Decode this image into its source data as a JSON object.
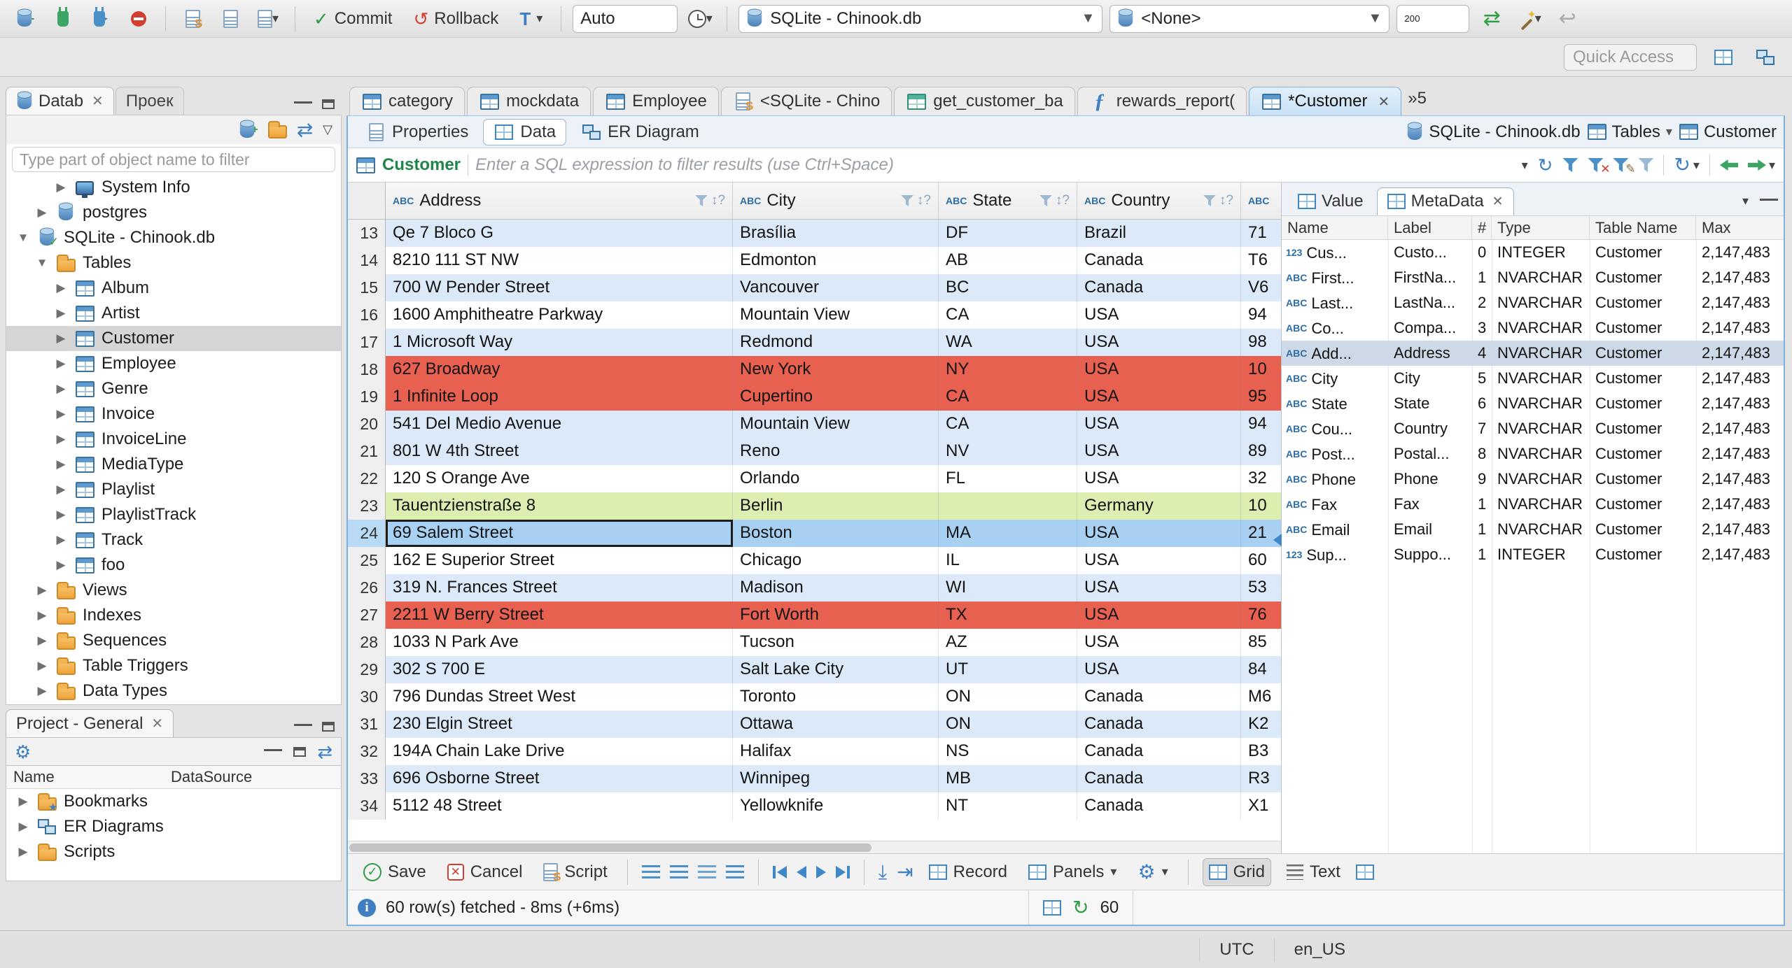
{
  "colors": {
    "accent": "#3f7fc1",
    "row_alt": "#dce9f8",
    "row_error": "#e8604f",
    "row_modified": "#ddefb0",
    "row_selected": "#a8d0f2"
  },
  "toolbar": {
    "commit_label": "Commit",
    "rollback_label": "Rollback",
    "txn_label": "T",
    "auto_commit": "Auto",
    "active_datasource": "SQLite - Chinook.db",
    "active_schema": "<None>",
    "fetch_size": "200",
    "quick_access_placeholder": "Quick Access"
  },
  "navigator": {
    "tab_database": "Datab",
    "tab_projects": "Проек",
    "filter_placeholder": "Type part of object name to filter",
    "tree": [
      {
        "label": "System Info",
        "icon": "system-info-icon",
        "arrow": "▶",
        "cls": "ind2"
      },
      {
        "label": "postgres",
        "icon": "database-icon",
        "arrow": "▶",
        "cls": "ind1"
      },
      {
        "label": "SQLite - Chinook.db",
        "icon": "database-connected-icon",
        "arrow": "▼",
        "cls": "ind0"
      },
      {
        "label": "Tables",
        "icon": "folder-icon",
        "arrow": "▼",
        "cls": "ind1"
      },
      {
        "label": "Album",
        "icon": "table-icon",
        "arrow": "▶",
        "cls": "ind2"
      },
      {
        "label": "Artist",
        "icon": "table-icon",
        "arrow": "▶",
        "cls": "ind2"
      },
      {
        "label": "Customer",
        "icon": "table-icon",
        "arrow": "▶",
        "cls": "ind2 selected"
      },
      {
        "label": "Employee",
        "icon": "table-icon",
        "arrow": "▶",
        "cls": "ind2"
      },
      {
        "label": "Genre",
        "icon": "table-icon",
        "arrow": "▶",
        "cls": "ind2"
      },
      {
        "label": "Invoice",
        "icon": "table-icon",
        "arrow": "▶",
        "cls": "ind2"
      },
      {
        "label": "InvoiceLine",
        "icon": "table-icon",
        "arrow": "▶",
        "cls": "ind2"
      },
      {
        "label": "MediaType",
        "icon": "table-icon",
        "arrow": "▶",
        "cls": "ind2"
      },
      {
        "label": "Playlist",
        "icon": "table-icon",
        "arrow": "▶",
        "cls": "ind2"
      },
      {
        "label": "PlaylistTrack",
        "icon": "table-icon",
        "arrow": "▶",
        "cls": "ind2"
      },
      {
        "label": "Track",
        "icon": "table-icon",
        "arrow": "▶",
        "cls": "ind2"
      },
      {
        "label": "foo",
        "icon": "table-icon",
        "arrow": "▶",
        "cls": "ind2"
      },
      {
        "label": "Views",
        "icon": "folder-icon",
        "arrow": "▶",
        "cls": "ind1"
      },
      {
        "label": "Indexes",
        "icon": "folder-icon",
        "arrow": "▶",
        "cls": "ind1"
      },
      {
        "label": "Sequences",
        "icon": "folder-icon",
        "arrow": "▶",
        "cls": "ind1"
      },
      {
        "label": "Table Triggers",
        "icon": "folder-icon",
        "arrow": "▶",
        "cls": "ind1"
      },
      {
        "label": "Data Types",
        "icon": "folder-icon",
        "arrow": "▶",
        "cls": "ind1"
      }
    ]
  },
  "project_panel": {
    "title": "Project - General",
    "col_name": "Name",
    "col_datasource": "DataSource",
    "items": [
      {
        "label": "Bookmarks",
        "icon": "bookmarks-folder-icon",
        "arrow": "▶"
      },
      {
        "label": "ER Diagrams",
        "icon": "er-diagrams-icon",
        "arrow": "▶"
      },
      {
        "label": "Scripts",
        "icon": "scripts-folder-icon",
        "arrow": "▶"
      }
    ]
  },
  "editor_tabs": {
    "tabs": [
      {
        "label": "category",
        "icon": "table-icon",
        "cls": ""
      },
      {
        "label": "mockdata",
        "icon": "table-icon",
        "cls": ""
      },
      {
        "label": "Employee",
        "icon": "table-icon",
        "cls": ""
      },
      {
        "label": "<SQLite - Chino",
        "icon": "sql-editor-icon",
        "cls": ""
      },
      {
        "label": "get_customer_ba",
        "icon": "view-icon",
        "cls": ""
      },
      {
        "label": "rewards_report(",
        "icon": "function-icon",
        "cls": ""
      },
      {
        "label": "*Customer",
        "icon": "table-icon",
        "cls": "active"
      }
    ],
    "overflow": "»5"
  },
  "result_tabs": {
    "tabs": [
      {
        "label": "Properties",
        "icon": "properties-icon",
        "cls": ""
      },
      {
        "label": "Data",
        "icon": "data-grid-icon",
        "cls": "active"
      },
      {
        "label": "ER Diagram",
        "icon": "er-diagram-icon",
        "cls": ""
      }
    ],
    "datasource": "SQLite - Chinook.db",
    "container": "Tables",
    "entity": "Customer"
  },
  "filter_bar": {
    "table": "Customer",
    "placeholder": "Enter a SQL expression to filter results (use Ctrl+Space)"
  },
  "grid": {
    "type_badge": "ABC",
    "columns": [
      "Address",
      "City",
      "State",
      "Country"
    ],
    "sort_hint": "↕?",
    "rows": [
      {
        "num": "13",
        "address": "Qe 7 Bloco G",
        "city": "Brasília",
        "state": "DF",
        "country": "Brazil",
        "postal": "71",
        "cls": "alt"
      },
      {
        "num": "14",
        "address": "8210 111 ST NW",
        "city": "Edmonton",
        "state": "AB",
        "country": "Canada",
        "postal": "T6",
        "cls": ""
      },
      {
        "num": "15",
        "address": "700 W Pender Street",
        "city": "Vancouver",
        "state": "BC",
        "country": "Canada",
        "postal": "V6",
        "cls": "alt"
      },
      {
        "num": "16",
        "address": "1600 Amphitheatre Parkway",
        "city": "Mountain View",
        "state": "CA",
        "country": "USA",
        "postal": "94",
        "cls": ""
      },
      {
        "num": "17",
        "address": "1 Microsoft Way",
        "city": "Redmond",
        "state": "WA",
        "country": "USA",
        "postal": "98",
        "cls": "alt"
      },
      {
        "num": "18",
        "address": "627 Broadway",
        "city": "New York",
        "state": "NY",
        "country": "USA",
        "postal": "10",
        "cls": "red"
      },
      {
        "num": "19",
        "address": "1 Infinite Loop",
        "city": "Cupertino",
        "state": "CA",
        "country": "USA",
        "postal": "95",
        "cls": "red"
      },
      {
        "num": "20",
        "address": "541 Del Medio Avenue",
        "city": "Mountain View",
        "state": "CA",
        "country": "USA",
        "postal": "94",
        "cls": "alt"
      },
      {
        "num": "21",
        "address": "801 W 4th Street",
        "city": "Reno",
        "state": "NV",
        "country": "USA",
        "postal": "89",
        "cls": "alt"
      },
      {
        "num": "22",
        "address": "120 S Orange Ave",
        "city": "Orlando",
        "state": "FL",
        "country": "USA",
        "postal": "32",
        "cls": ""
      },
      {
        "num": "23",
        "address": "Tauentzienstraße 8",
        "city": "Berlin",
        "state": "",
        "country": "Germany",
        "postal": "10",
        "cls": "green"
      },
      {
        "num": "24",
        "address": "69 Salem Street",
        "city": "Boston",
        "state": "MA",
        "country": "USA",
        "postal": "21",
        "cls": "sel"
      },
      {
        "num": "25",
        "address": "162 E Superior Street",
        "city": "Chicago",
        "state": "IL",
        "country": "USA",
        "postal": "60",
        "cls": ""
      },
      {
        "num": "26",
        "address": "319 N. Frances Street",
        "city": "Madison",
        "state": "WI",
        "country": "USA",
        "postal": "53",
        "cls": "alt"
      },
      {
        "num": "27",
        "address": "2211 W Berry Street",
        "city": "Fort Worth",
        "state": "TX",
        "country": "USA",
        "postal": "76",
        "cls": "red"
      },
      {
        "num": "28",
        "address": "1033 N Park Ave",
        "city": "Tucson",
        "state": "AZ",
        "country": "USA",
        "postal": "85",
        "cls": ""
      },
      {
        "num": "29",
        "address": "302 S 700 E",
        "city": "Salt Lake City",
        "state": "UT",
        "country": "USA",
        "postal": "84",
        "cls": "alt"
      },
      {
        "num": "30",
        "address": "796 Dundas Street West",
        "city": "Toronto",
        "state": "ON",
        "country": "Canada",
        "postal": "M6",
        "cls": ""
      },
      {
        "num": "31",
        "address": "230 Elgin Street",
        "city": "Ottawa",
        "state": "ON",
        "country": "Canada",
        "postal": "K2",
        "cls": "alt"
      },
      {
        "num": "32",
        "address": "194A Chain Lake Drive",
        "city": "Halifax",
        "state": "NS",
        "country": "Canada",
        "postal": "B3",
        "cls": ""
      },
      {
        "num": "33",
        "address": "696 Osborne Street",
        "city": "Winnipeg",
        "state": "MB",
        "country": "Canada",
        "postal": "R3",
        "cls": "alt"
      },
      {
        "num": "34",
        "address": "5112 48 Street",
        "city": "Yellowknife",
        "state": "NT",
        "country": "Canada",
        "postal": "X1",
        "cls": ""
      }
    ]
  },
  "value_panel": {
    "tab_value": "Value",
    "tab_metadata": "MetaData",
    "columns": {
      "name": "Name",
      "label": "Label",
      "ord": "#",
      "type": "Type",
      "table": "Table Name",
      "max": "Max"
    },
    "rows": [
      {
        "kind": "123",
        "name": "Cus...",
        "label": "Custo...",
        "ord": "0",
        "type": "INTEGER",
        "table": "Customer",
        "max": "2,147,483",
        "cls": ""
      },
      {
        "kind": "ABC",
        "name": "First...",
        "label": "FirstNa...",
        "ord": "1",
        "type": "NVARCHAR",
        "table": "Customer",
        "max": "2,147,483",
        "cls": ""
      },
      {
        "kind": "ABC",
        "name": "Last...",
        "label": "LastNa...",
        "ord": "2",
        "type": "NVARCHAR",
        "table": "Customer",
        "max": "2,147,483",
        "cls": ""
      },
      {
        "kind": "ABC",
        "name": "Co...",
        "label": "Compa...",
        "ord": "3",
        "type": "NVARCHAR",
        "table": "Customer",
        "max": "2,147,483",
        "cls": ""
      },
      {
        "kind": "ABC",
        "name": "Add...",
        "label": "Address",
        "ord": "4",
        "type": "NVARCHAR",
        "table": "Customer",
        "max": "2,147,483",
        "cls": "selected"
      },
      {
        "kind": "ABC",
        "name": "City",
        "label": "City",
        "ord": "5",
        "type": "NVARCHAR",
        "table": "Customer",
        "max": "2,147,483",
        "cls": ""
      },
      {
        "kind": "ABC",
        "name": "State",
        "label": "State",
        "ord": "6",
        "type": "NVARCHAR",
        "table": "Customer",
        "max": "2,147,483",
        "cls": ""
      },
      {
        "kind": "ABC",
        "name": "Cou...",
        "label": "Country",
        "ord": "7",
        "type": "NVARCHAR",
        "table": "Customer",
        "max": "2,147,483",
        "cls": ""
      },
      {
        "kind": "ABC",
        "name": "Post...",
        "label": "Postal...",
        "ord": "8",
        "type": "NVARCHAR",
        "table": "Customer",
        "max": "2,147,483",
        "cls": ""
      },
      {
        "kind": "ABC",
        "name": "Phone",
        "label": "Phone",
        "ord": "9",
        "type": "NVARCHAR",
        "table": "Customer",
        "max": "2,147,483",
        "cls": ""
      },
      {
        "kind": "ABC",
        "name": "Fax",
        "label": "Fax",
        "ord": "1",
        "type": "NVARCHAR",
        "table": "Customer",
        "max": "2,147,483",
        "cls": ""
      },
      {
        "kind": "ABC",
        "name": "Email",
        "label": "Email",
        "ord": "1",
        "type": "NVARCHAR",
        "table": "Customer",
        "max": "2,147,483",
        "cls": ""
      },
      {
        "kind": "123",
        "name": "Sup...",
        "label": "Suppo...",
        "ord": "1",
        "type": "INTEGER",
        "table": "Customer",
        "max": "2,147,483",
        "cls": ""
      }
    ]
  },
  "bottom_toolbar": {
    "save": "Save",
    "cancel": "Cancel",
    "script": "Script",
    "record": "Record",
    "panels": "Panels",
    "grid": "Grid",
    "text": "Text"
  },
  "result_status": {
    "message": "60 row(s) fetched - 8ms (+6ms)",
    "row_count": "60"
  },
  "statusbar": {
    "timezone": "UTC",
    "locale": "en_US"
  }
}
